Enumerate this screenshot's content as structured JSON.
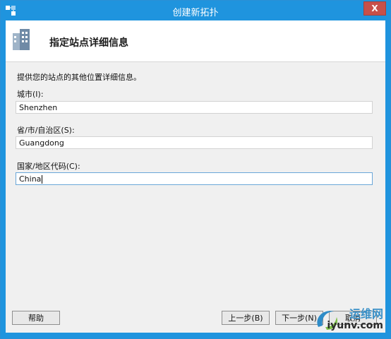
{
  "window": {
    "title": "创建新拓扑",
    "close_glyph": "X"
  },
  "header": {
    "title": "指定站点详细信息"
  },
  "instructions": "提供您的站点的其他位置详细信息。",
  "fields": {
    "city": {
      "label": "城市(I):",
      "value": "Shenzhen"
    },
    "province": {
      "label": "省/市/自治区(S):",
      "value": "Guangdong"
    },
    "country": {
      "label": "国家/地区代码(C):",
      "value": "China"
    }
  },
  "buttons": {
    "help": "帮助",
    "back": "上一步(B)",
    "next": "下一步(N)",
    "cancel": "取消"
  },
  "watermark": {
    "line1": "运维网",
    "line2": "iyunv.com"
  },
  "colors": {
    "titlebar": "#1f94de",
    "close": "#c7504a",
    "dialog_bg": "#f0f0f0"
  }
}
